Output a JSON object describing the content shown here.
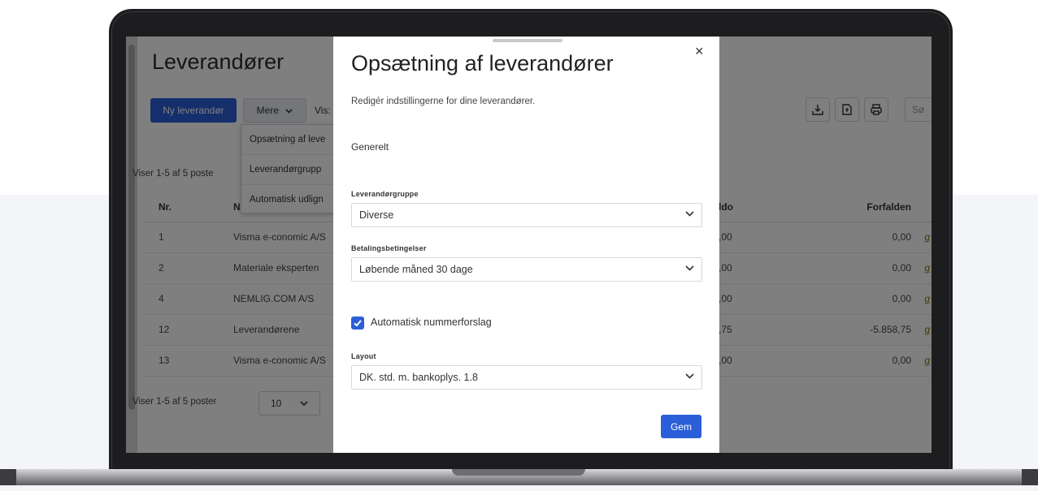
{
  "page": {
    "title": "Leverandører",
    "new_button": "Ny leverandør",
    "more_button": "Mere",
    "view_label": "Vis:",
    "showing_top": "Viser 1-5 af 5 poste",
    "showing_bottom": "Viser 1-5 af 5 poster",
    "page_size": "10",
    "search_placeholder": "Sø"
  },
  "dropdown": {
    "items": [
      {
        "label": "Opsætning af leve"
      },
      {
        "label": "Leverandørgrupp"
      },
      {
        "label": "Automatisk udlign"
      }
    ]
  },
  "table": {
    "headers": {
      "nr": "Nr.",
      "name": "N",
      "saldo": "ldo",
      "forfalden": "Forfalden"
    },
    "rows": [
      {
        "nr": "1",
        "name": "Visma e-conomic A/S",
        "saldo": ",00",
        "forfalden": "0,00",
        "edit": "g"
      },
      {
        "nr": "2",
        "name": "Materiale eksperten",
        "saldo": ",00",
        "forfalden": "0,00",
        "edit": "g"
      },
      {
        "nr": "4",
        "name": "NEMLIG.COM A/S",
        "saldo": ",00",
        "forfalden": "0,00",
        "edit": "g"
      },
      {
        "nr": "12",
        "name": "Leverandørene",
        "saldo": ",75",
        "forfalden": "-5.858,75",
        "edit": "g"
      },
      {
        "nr": "13",
        "name": "Visma e-conomic A/S",
        "saldo": ",00",
        "forfalden": "0,00",
        "edit": "g"
      }
    ]
  },
  "modal": {
    "title": "Opsætning af leverandører",
    "close": "×",
    "description": "Redigér indstillingerne for dine leverandører.",
    "section": "Generelt",
    "group_label": "Leverandørgruppe",
    "group_value": "Diverse",
    "terms_label": "Betalingsbetingelser",
    "terms_value": "Løbende måned 30 dage",
    "auto_number_label": "Automatisk nummerforslag",
    "auto_number_checked": true,
    "layout_label": "Layout",
    "layout_value": "DK. std. m. bankoplys. 1.8",
    "save_button": "Gem"
  },
  "colors": {
    "primary": "#2b5fd9",
    "overlay": "rgba(0,0,0,0.5)"
  }
}
